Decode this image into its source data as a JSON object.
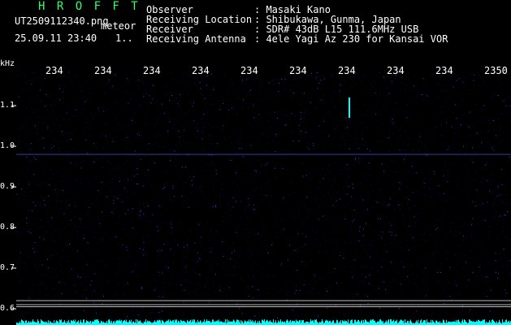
{
  "header": {
    "brand": "H R O F F T",
    "filename": "UT2509112340.png",
    "tag": "meteor",
    "datetime": "25.09.11 23:40",
    "count": "1..",
    "fields": [
      {
        "label": "Observer",
        "value": ": Masaki Kano"
      },
      {
        "label": "Receiving Location",
        "value": ": Shibukawa, Gunma, Japan"
      },
      {
        "label": "Receiver",
        "value": ": SDR# 43dB L15 111.6MHz USB"
      },
      {
        "label": "Receiving Antenna",
        "value": ": 4ele Yagi Az 230 for Kansai VOR"
      }
    ]
  },
  "colors": {
    "background": "#000000",
    "noise_dark": "#0a0a5a",
    "noise_bright": "#3a3aff",
    "signal": "#00ffff",
    "text": "#ffffff",
    "brand": "#33ff66"
  },
  "chart_data": {
    "type": "heatmap",
    "title": "",
    "ylabel": "kHz",
    "yticks": [
      "1.1",
      "1.0",
      "0.9",
      "0.8",
      "0.7",
      "0.6"
    ],
    "xticks": [
      "234",
      "234",
      "234",
      "234",
      "234",
      "234",
      "234",
      "234",
      "234",
      "2350"
    ],
    "reference_lines_khz": [
      0.98,
      0.62,
      0.61,
      0.605
    ],
    "meteor_echo": {
      "x_tick_index": 6.3,
      "y_khz_top": 1.12,
      "y_khz_bottom": 1.07
    }
  }
}
